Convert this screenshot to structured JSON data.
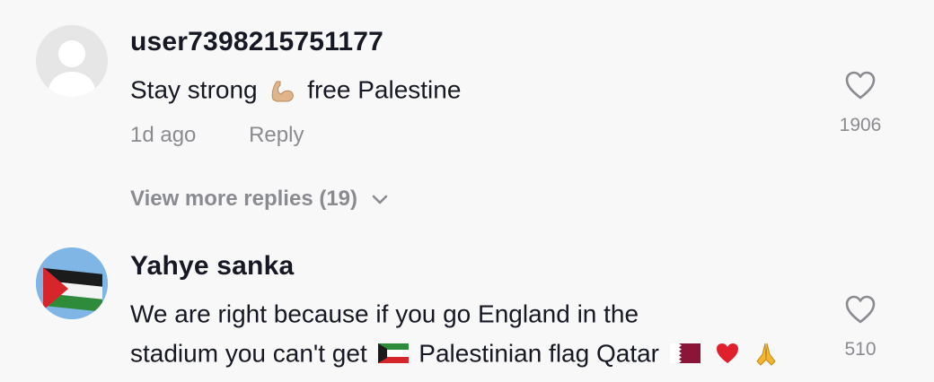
{
  "comments": [
    {
      "username": "user7398215751177",
      "text_before": "Stay strong",
      "text_after": "free Palestine",
      "time": "1d ago",
      "reply_label": "Reply",
      "likes": "1906",
      "avatar": "default-user-icon",
      "emoji": [
        "flexed-biceps-icon"
      ]
    },
    {
      "username": "Yahye sanka",
      "text_line1": "We are right because if you go England in the",
      "text_line2_before": "stadium you can't get",
      "text_line2_after": "Palestinian flag Qatar",
      "likes": "510",
      "avatar": "palestine-flag-avatar",
      "emoji": [
        "kuwait-flag-icon",
        "qatar-flag-icon",
        "red-heart-icon",
        "folded-hands-icon"
      ]
    }
  ],
  "view_more_replies": "View more replies (19)",
  "colors": {
    "background": "#f8f8f8",
    "primary_text": "#161823",
    "secondary_text": "#8a8b91"
  }
}
